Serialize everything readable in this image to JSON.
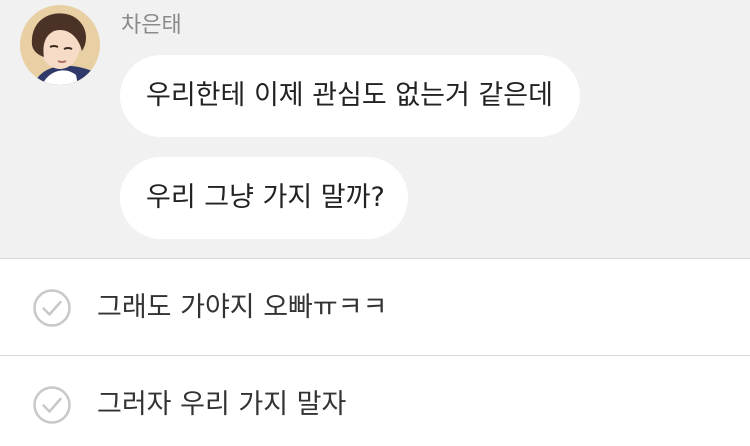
{
  "chat": {
    "sender_name": "차은태",
    "messages": [
      {
        "text": "우리한테 이제 관심도 없는거 같은데"
      },
      {
        "text": "우리 그냥 가지 말까?"
      }
    ]
  },
  "choices": [
    {
      "label": "그래도 가야지 오빠ㅠㅋㅋ",
      "icon": "check-circle-icon"
    },
    {
      "label": "그러자 우리 가지 말자",
      "icon": "check-circle-icon"
    }
  ],
  "colors": {
    "chat_background": "#f1f1f1",
    "bubble_background": "#ffffff",
    "sender_name": "#8a8a8a",
    "divider": "#d6d6d6",
    "check_icon": "#c8c8c8"
  }
}
